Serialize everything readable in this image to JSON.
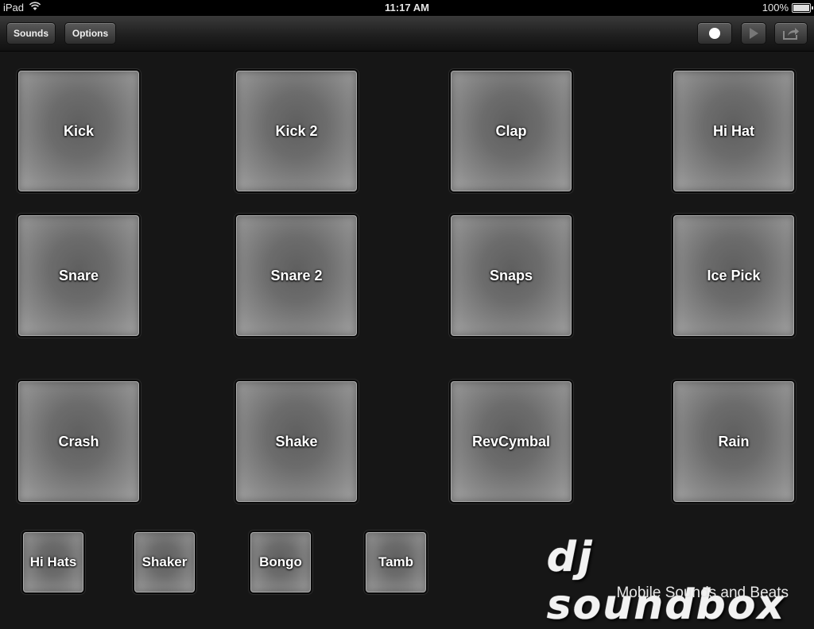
{
  "status_bar": {
    "device": "iPad",
    "time": "11:17 AM",
    "battery": "100%",
    "battery_level": 1.0
  },
  "toolbar": {
    "sounds_label": "Sounds",
    "options_label": "Options",
    "record_icon": "record-icon",
    "play_icon": "play-icon",
    "share_icon": "share-icon"
  },
  "pads": [
    {
      "label": "Kick"
    },
    {
      "label": "Kick 2"
    },
    {
      "label": "Clap"
    },
    {
      "label": "Hi Hat"
    },
    {
      "label": "Snare"
    },
    {
      "label": "Snare 2"
    },
    {
      "label": "Snaps"
    },
    {
      "label": "Ice Pick"
    },
    {
      "label": "Crash"
    },
    {
      "label": "Shake"
    },
    {
      "label": "RevCymbal"
    },
    {
      "label": "Rain"
    }
  ],
  "small_pads": [
    {
      "label": "Hi Hats"
    },
    {
      "label": "Shaker"
    },
    {
      "label": "Bongo"
    },
    {
      "label": "Tamb"
    }
  ],
  "logo": {
    "brand": "dj soundbox",
    "tagline": "Mobile Sounds and Beats"
  }
}
